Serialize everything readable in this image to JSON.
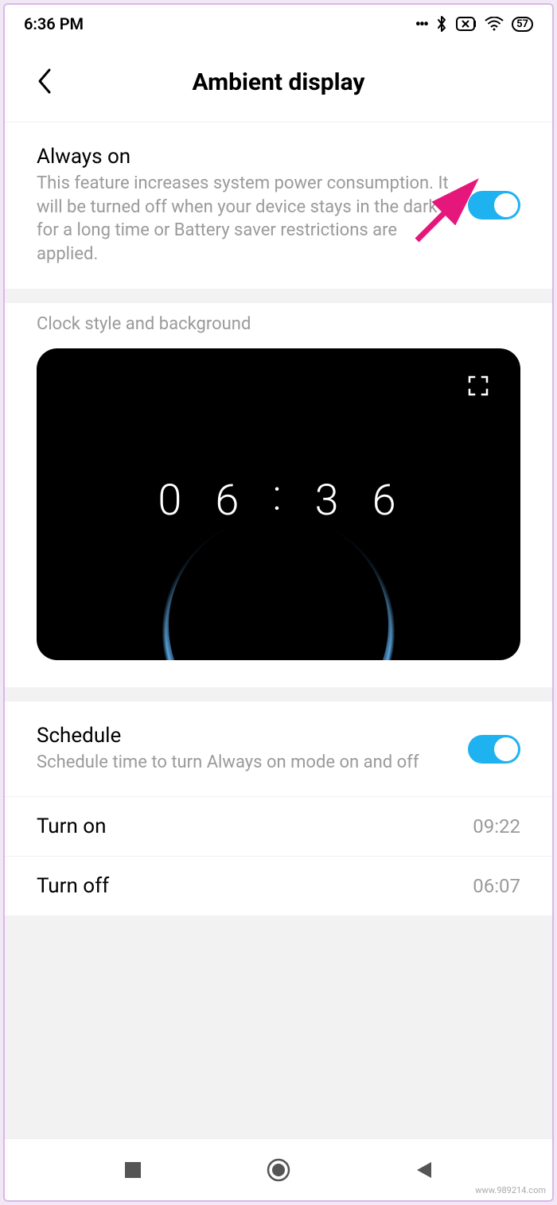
{
  "status": {
    "time": "6:36 PM",
    "battery": "57"
  },
  "appbar": {
    "title": "Ambient display"
  },
  "always_on": {
    "title": "Always on",
    "desc": "This feature increases system power consumption. It will be turned off when your device stays in the dark for a long time or Battery saver restrictions are applied.",
    "enabled": true
  },
  "preview": {
    "section_label": "Clock style and background",
    "clock": {
      "d1": "0",
      "d2": "6",
      "colon": ":",
      "d3": "3",
      "d4": "6"
    }
  },
  "schedule": {
    "title": "Schedule",
    "desc": "Schedule time to turn Always on mode on and off",
    "enabled": true
  },
  "turn_on": {
    "label": "Turn on",
    "value": "09:22"
  },
  "turn_off": {
    "label": "Turn off",
    "value": "06:07"
  },
  "watermark": "www.989214.com"
}
